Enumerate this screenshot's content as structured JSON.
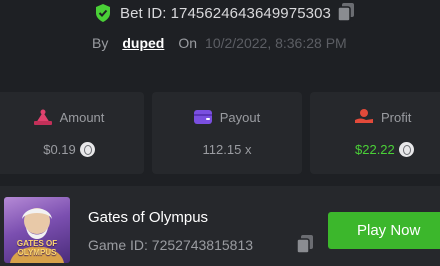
{
  "bet": {
    "label": "Bet ID:",
    "id": "1745624643649975303"
  },
  "meta": {
    "by_label": "By",
    "user": "duped",
    "on_label": "On",
    "date": "10/2/2022, 8:36:28 PM"
  },
  "stats": {
    "amount": {
      "label": "Amount",
      "value": "$0.19",
      "icon": "money-bag-icon",
      "color": "#e0426e"
    },
    "payout": {
      "label": "Payout",
      "value": "112.15 x",
      "icon": "wallet-icon",
      "color": "#7a4fe0"
    },
    "profit": {
      "label": "Profit",
      "value": "$22.22",
      "icon": "hand-coin-icon",
      "color": "#e34a3a"
    }
  },
  "game": {
    "thumbnail_text": "GATES OF OLYMPUS",
    "name": "Gates of Olympus",
    "id_label": "Game ID:",
    "id": "7252743815813",
    "play_label": "Play Now"
  },
  "colors": {
    "background": "#1e2024",
    "card": "#26282c",
    "accent_green": "#3cb72c",
    "profit_green": "#4ad037"
  }
}
